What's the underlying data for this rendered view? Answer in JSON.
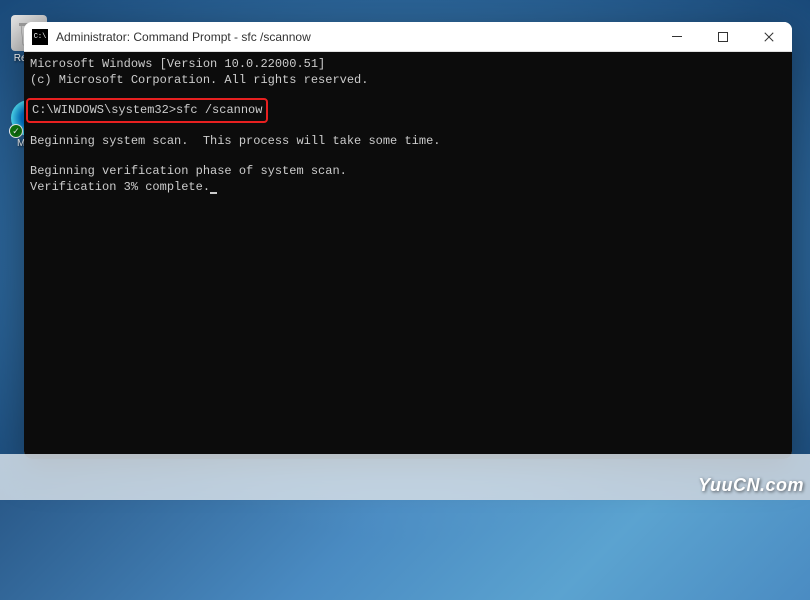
{
  "desktop": {
    "icons": {
      "recycle_bin": {
        "label": "Recy..."
      },
      "edge": {
        "label": "Mic..."
      }
    }
  },
  "window": {
    "title": "Administrator: Command Prompt - sfc  /scannow"
  },
  "terminal": {
    "line_version": "Microsoft Windows [Version 10.0.22000.51]",
    "line_copyright": "(c) Microsoft Corporation. All rights reserved.",
    "prompt": "C:\\WINDOWS\\system32>",
    "command": "sfc /scannow",
    "line_scan_start": "Beginning system scan.  This process will take some time.",
    "line_verification_phase": "Beginning verification phase of system scan.",
    "line_progress": "Verification 3% complete."
  },
  "highlight": {
    "color": "#e82020"
  },
  "watermark": {
    "text": "YuuCN.com"
  }
}
